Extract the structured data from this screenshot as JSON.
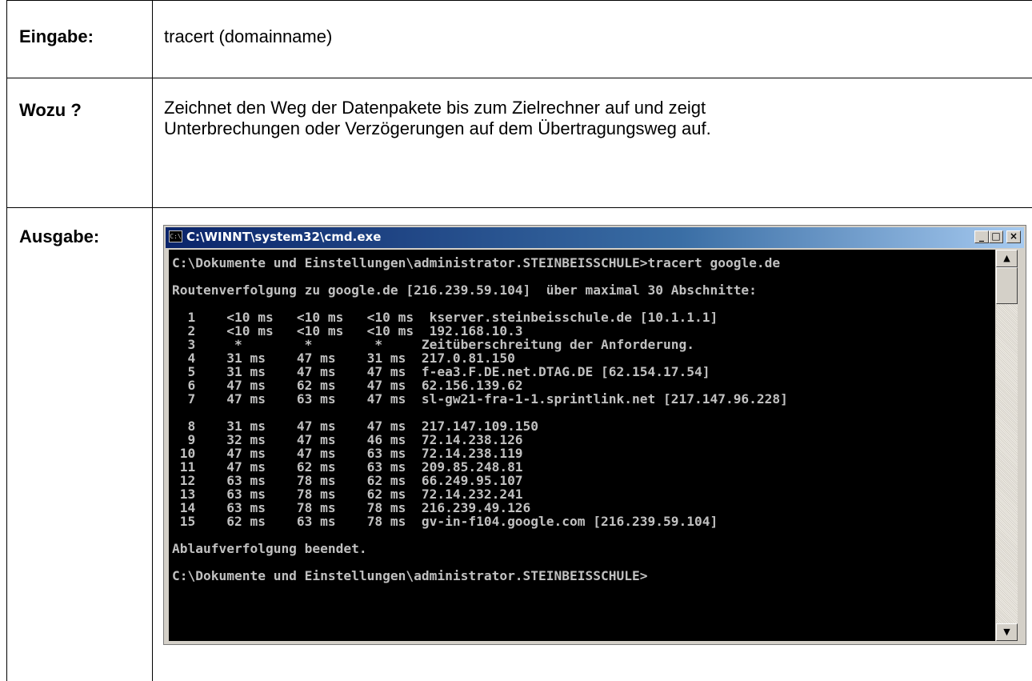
{
  "table": {
    "rows": [
      {
        "label": "Eingabe:",
        "text": "tracert (domainname)"
      },
      {
        "label": "Wozu ?",
        "text_lines": [
          "Zeichnet den Weg der Datenpakete bis zum Zielrechner auf und zeigt",
          "Unterbrechungen oder Verzögerungen auf dem Übertragungsweg auf."
        ]
      },
      {
        "label": "Ausgabe:"
      }
    ]
  },
  "window": {
    "title": "C:\\WINNT\\system32\\cmd.exe",
    "icon": "cmd-icon",
    "buttons": {
      "minimize": "_",
      "maximize": "□",
      "close": "×"
    }
  },
  "console": {
    "lines": [
      "C:\\Dokumente und Einstellungen\\administrator.STEINBEISSCHULE>tracert google.de",
      "",
      "Routenverfolgung zu google.de [216.239.59.104]  über maximal 30 Abschnitte:",
      "",
      "  1    <10 ms   <10 ms   <10 ms  kserver.steinbeisschule.de [10.1.1.1]",
      "  2    <10 ms   <10 ms   <10 ms  192.168.10.3",
      "  3     *        *        *     Zeitüberschreitung der Anforderung.",
      "  4    31 ms    47 ms    31 ms  217.0.81.150",
      "  5    31 ms    47 ms    47 ms  f-ea3.F.DE.net.DTAG.DE [62.154.17.54]",
      "  6    47 ms    62 ms    47 ms  62.156.139.62",
      "  7    47 ms    63 ms    47 ms  sl-gw21-fra-1-1.sprintlink.net [217.147.96.228]",
      "",
      "  8    31 ms    47 ms    47 ms  217.147.109.150",
      "  9    32 ms    47 ms    46 ms  72.14.238.126",
      " 10    47 ms    47 ms    63 ms  72.14.238.119",
      " 11    47 ms    62 ms    63 ms  209.85.248.81",
      " 12    63 ms    78 ms    62 ms  66.249.95.107",
      " 13    63 ms    78 ms    62 ms  72.14.232.241",
      " 14    63 ms    78 ms    78 ms  216.239.49.126",
      " 15    62 ms    63 ms    78 ms  gv-in-f104.google.com [216.239.59.104]",
      "",
      "Ablaufverfolgung beendet.",
      "",
      "C:\\Dokumente und Einstellungen\\administrator.STEINBEISSCHULE>"
    ]
  },
  "scrollbar": {
    "up": "▲",
    "down": "▼"
  }
}
